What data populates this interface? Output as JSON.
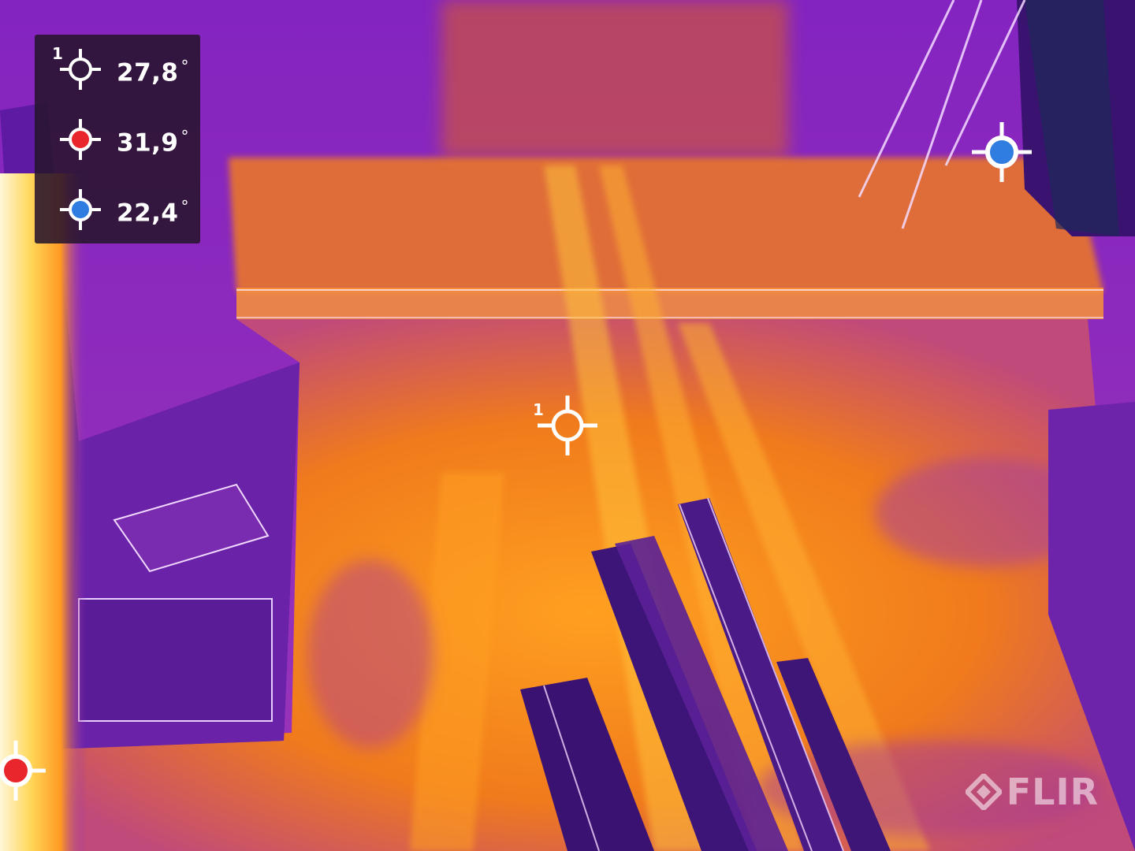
{
  "legend": {
    "spot": {
      "index": "1",
      "value": "27,8",
      "unit": "°",
      "icon": "crosshair-white-icon"
    },
    "max": {
      "value": "31,9",
      "unit": "°",
      "icon": "crosshair-red-icon",
      "color": "#e8262b"
    },
    "min": {
      "value": "22,4",
      "unit": "°",
      "icon": "crosshair-blue-icon",
      "color": "#2f7de1"
    }
  },
  "center_marker": {
    "index": "1",
    "icon": "crosshair-white-icon"
  },
  "brand": {
    "name": "FLIR",
    "icon": "flir-logo-icon"
  },
  "palette": {
    "hot": "#ffe27a",
    "warm": "#ff8a1c",
    "mid": "#d94a6b",
    "cool": "#7a1fb8",
    "cold": "#3a1270"
  }
}
